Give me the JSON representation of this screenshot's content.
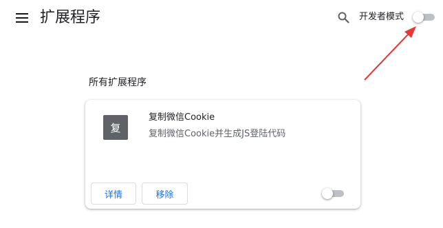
{
  "header": {
    "title": "扩展程序",
    "menu_icon": "hamburger-menu-icon",
    "search_icon": "search-icon",
    "dev_mode_label": "开发者模式",
    "dev_mode_enabled": false
  },
  "section": {
    "title": "所有扩展程序"
  },
  "extensions": [
    {
      "icon_text": "复",
      "name": "复制微信Cookie",
      "description": "复制微信Cookie并生成JS登陆代码",
      "details_label": "详情",
      "remove_label": "移除",
      "enabled": false
    }
  ],
  "colors": {
    "accent": "#1a73e8",
    "annotation_arrow": "#e53935",
    "icon_bg": "#5f6368",
    "toggle_off_track": "#bdc1c6"
  }
}
